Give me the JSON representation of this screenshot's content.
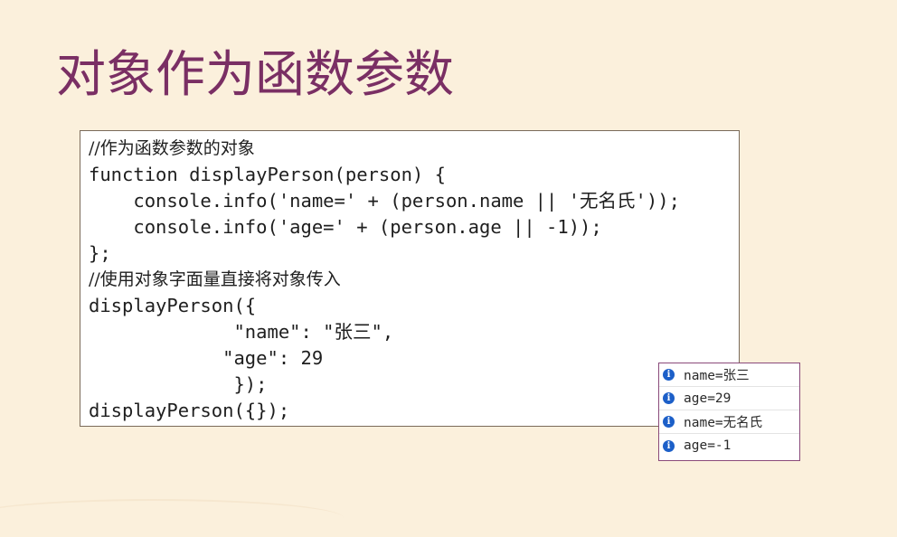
{
  "slide": {
    "title": "对象作为函数参数"
  },
  "code": {
    "lines": [
      {
        "text": "//作为函数参数的对象",
        "kind": "comment"
      },
      {
        "text": "function displayPerson(person) {",
        "kind": "code"
      },
      {
        "text": "    console.info('name=' + (person.name || '无名氏'));",
        "kind": "code"
      },
      {
        "text": "    console.info('age=' + (person.age || -1));",
        "kind": "code"
      },
      {
        "text": "};",
        "kind": "code"
      },
      {
        "text": "//使用对象字面量直接将对象传入",
        "kind": "comment"
      },
      {
        "text": "displayPerson({",
        "kind": "code"
      },
      {
        "text": "             \"name\": \"张三\",",
        "kind": "code"
      },
      {
        "text": "            \"age\": 29",
        "kind": "code"
      },
      {
        "text": "             });",
        "kind": "code"
      },
      {
        "text": "displayPerson({});",
        "kind": "code"
      }
    ]
  },
  "console": {
    "icon": "info-icon",
    "icon_color": "#1c5fc8",
    "entries": [
      {
        "text": "name=张三"
      },
      {
        "text": "age=29"
      },
      {
        "text": "name=无名氏"
      },
      {
        "text": "age=-1"
      }
    ]
  },
  "colors": {
    "background": "#fbf0dc",
    "title": "#7a2f64"
  }
}
